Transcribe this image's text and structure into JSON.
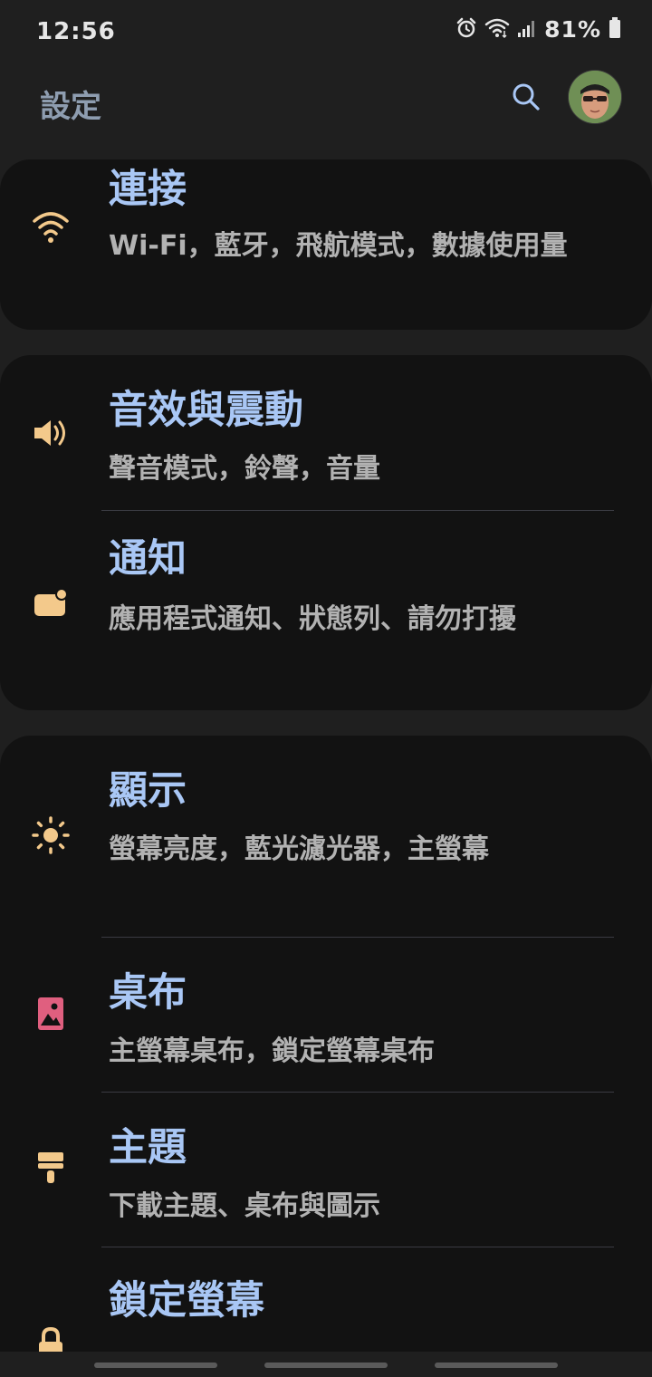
{
  "status_bar": {
    "time": "12:56",
    "battery_percent": "81%",
    "icons": [
      "alarm-icon",
      "wifi-icon",
      "signal-icon",
      "battery-icon"
    ]
  },
  "header": {
    "title": "設定",
    "search_icon": "search-icon",
    "avatar": "avatar"
  },
  "colors": {
    "background": "#1f1f1f",
    "card": "#121212",
    "title": "#a9c7f5",
    "subtitle": "#b2b2b2",
    "header_title": "#8e9db0",
    "icon_accent": "#f3c98b",
    "wallpaper_icon": "#e05f7f"
  },
  "settings": {
    "connections": {
      "title": "連接",
      "subtitle": "Wi-Fi，藍牙，飛航模式，數據使用量",
      "icon": "wifi-icon"
    },
    "sounds": {
      "title": "音效與震動",
      "subtitle": "聲音模式，鈴聲，音量",
      "icon": "speaker-icon"
    },
    "notifications": {
      "title": "通知",
      "subtitle": "應用程式通知、狀態列、請勿打擾",
      "icon": "notification-icon"
    },
    "display": {
      "title": "顯示",
      "subtitle": "螢幕亮度，藍光濾光器，主螢幕",
      "icon": "brightness-icon"
    },
    "wallpaper": {
      "title": "桌布",
      "subtitle": "主螢幕桌布，鎖定螢幕桌布",
      "icon": "wallpaper-icon"
    },
    "themes": {
      "title": "主題",
      "subtitle": "下載主題、桌布與圖示",
      "icon": "paintbrush-icon"
    },
    "lock_screen": {
      "title": "鎖定螢幕",
      "icon": "lock-icon"
    }
  }
}
